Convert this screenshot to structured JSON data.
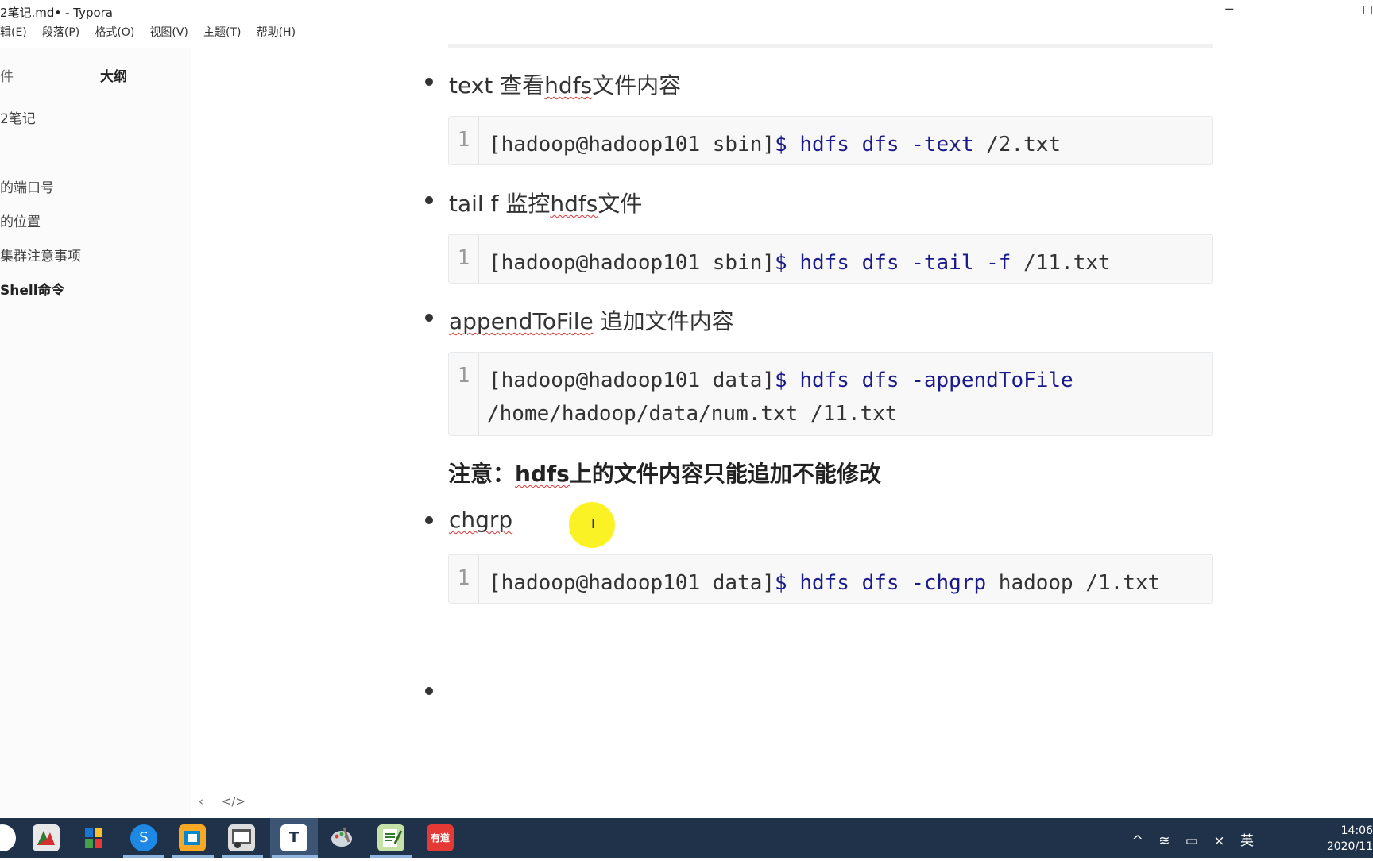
{
  "window": {
    "title": "2笔记.md• - Typora"
  },
  "menu": {
    "items": [
      "编辑(E)",
      "段落(P)",
      "格式(O)",
      "视图(V)",
      "主题(T)",
      "帮助(H)"
    ],
    "first_visible": "辑(E)"
  },
  "sidebar": {
    "tab_files": "件",
    "tab_outline": "大纲",
    "outline": [
      {
        "label": "2笔记"
      },
      {
        "label": "的端口号"
      },
      {
        "label": "的位置"
      },
      {
        "label": "集群注意事项"
      },
      {
        "label": "Shell命令"
      }
    ]
  },
  "footer": {
    "back_icon": "‹",
    "source_icon": "</>"
  },
  "content": {
    "items": [
      {
        "prefix": "text 查看",
        "underlined": "hdfs",
        "suffix": "文件内容",
        "code": {
          "line_no": "1",
          "prompt": "[hadoop@hadoop101 sbin]",
          "cmd": "$ hdfs dfs -text",
          "arg": " /2.txt"
        }
      },
      {
        "prefix": "tail f 监控",
        "underlined": "hdfs",
        "suffix": "文件",
        "code": {
          "line_no": "1",
          "prompt": "[hadoop@hadoop101 sbin]",
          "cmd": "$ hdfs dfs -tail -f",
          "arg": " /11.txt"
        }
      },
      {
        "prefix": "",
        "underlined": "appendToFile",
        "suffix": " 追加文件内容",
        "code": {
          "line_no": "1",
          "prompt": "[hadoop@hadoop101 data]",
          "cmd": "$ hdfs dfs -appendToFile",
          "arg": "",
          "arg_line2": "/home/hadoop/data/num.txt /11.txt"
        }
      },
      {
        "prefix": "",
        "underlined": "chgrp",
        "suffix": "",
        "code": {
          "line_no": "1",
          "prompt": "[hadoop@hadoop101 data]",
          "cmd": "$ hdfs dfs -chgrp",
          "arg": " hadoop /1.txt"
        }
      }
    ],
    "note": {
      "prefix": "注意：",
      "underlined": "hdfs",
      "suffix": "上的文件内容只能追加不能修改"
    }
  },
  "taskbar": {
    "icons": [
      "circle-app",
      "wps-app",
      "puzzle-app",
      "sogou-app",
      "folder-app",
      "browser-app",
      "typora-app",
      "paint-app",
      "notepad-app",
      "youdao-app"
    ],
    "labels": {
      "sogou": "S",
      "typora": "T",
      "youdao": "有道"
    },
    "ime": "英",
    "time": "14:06",
    "date": "2020/11"
  },
  "colors": {
    "taskbar": "#1f3249",
    "cursor_highlight": "#faf000",
    "code_keyword": "#1a1a8c"
  }
}
